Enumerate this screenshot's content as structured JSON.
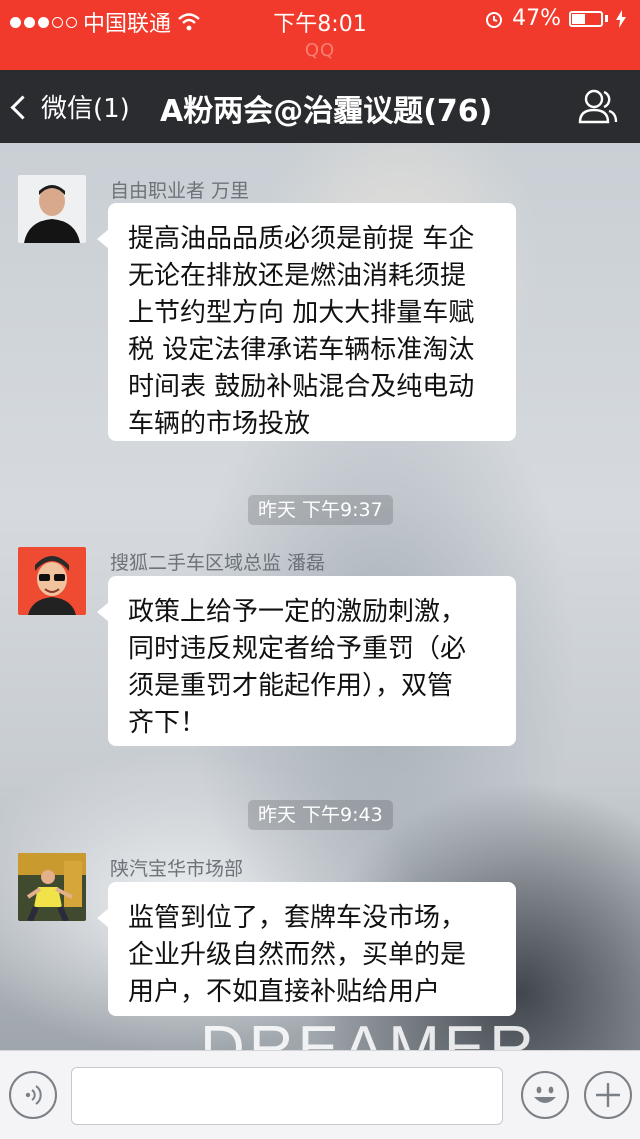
{
  "status_bar": {
    "carrier": "中国联通",
    "time": "下午8:01",
    "battery": "47%",
    "battery_level": 0.47,
    "overlay_text": "QQ"
  },
  "nav": {
    "back_label": "微信(1)",
    "title": "A粉两会@治霾议题(76)"
  },
  "messages": [
    {
      "sender": "自由职业者 万里",
      "text_lines": [
        "提高油品品质必须是前提 车企",
        "无论在排放还是燃油消耗须提",
        "上节约型方向 加大大排量车赋",
        "税 设定法律承诺车辆标准淘汰",
        "时间表 鼓励补贴混合及纯电动",
        "车辆的市场投放"
      ]
    },
    {
      "time": "昨天 下午9:37",
      "sender": "搜狐二手车区域总监 潘磊",
      "text_lines": [
        "政策上给予一定的激励刺激，",
        "同时违反规定者给予重罚（必",
        "须是重罚才能起作用），双管",
        "齐下！"
      ]
    },
    {
      "time": "昨天 下午9:43",
      "sender": "陕汽宝华市场部",
      "text_lines": [
        "监管到位了，套牌车没市场，",
        "企业升级自然而然，买单的是",
        "用户，不如直接补贴给用户"
      ]
    }
  ],
  "background_watermark": "DREAMER",
  "colors": {
    "status_bar": "#f23a2c",
    "nav_bar": "#2a2c2f",
    "bubble": "#ffffff"
  },
  "icons": {
    "voice": "voice-icon",
    "emoji": "emoji-icon",
    "add": "add-icon",
    "contacts": "contacts-icon",
    "back": "chevron-left-icon"
  }
}
